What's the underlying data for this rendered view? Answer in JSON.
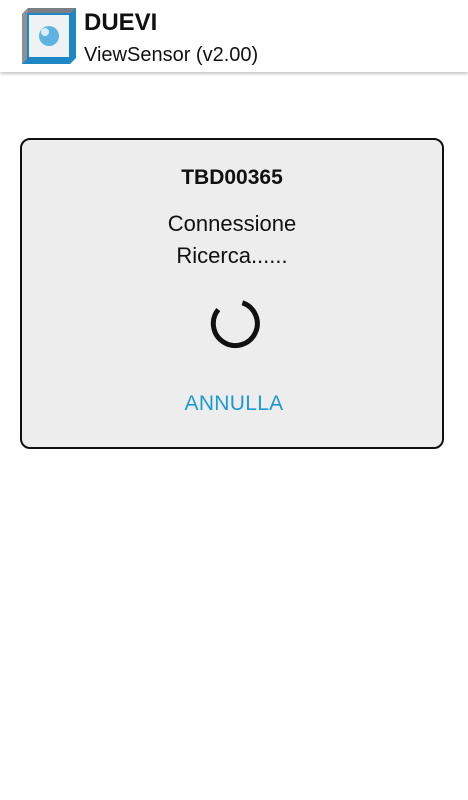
{
  "app": {
    "title": "DUEVI",
    "subtitle": "ViewSensor (v2.00)",
    "logo_icon": "duevi-logo-icon"
  },
  "dialog": {
    "device_name": "TBD00365",
    "status_line_1": "Connessione",
    "status_line_2": "Ricerca......",
    "cancel_label": "ANNULLA",
    "spinner_icon": "loading-spinner-icon"
  },
  "colors": {
    "accent": "#1b9bd1",
    "dialog_background": "#ededed",
    "text": "#111111"
  }
}
